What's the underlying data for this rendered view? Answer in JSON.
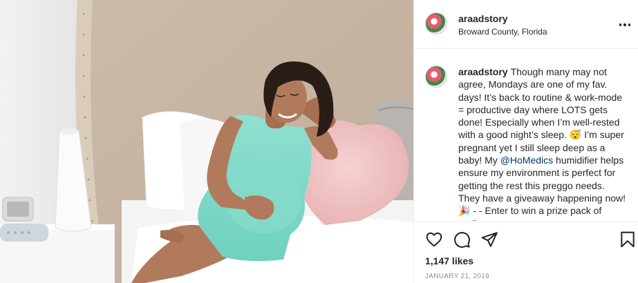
{
  "post": {
    "username": "araadstory",
    "location": "Broward County, Florida",
    "caption": {
      "username": "araadstory",
      "text_before_mention": "Though many may not agree, Mondays are one of my fav. days! It’s back to routine & work-mode = productive day where LOTS gets done! Especially when I’m well-rested with a good night’s sleep. 😴 I’m super pregnant yet I still sleep deep as a baby! My ",
      "mention": "@HoMedics",
      "text_after_mention": " humidifier helps ensure my environment is perfect for getting the rest this preggo needs. They have a giveaway happening now! 🎉 - - Enter to win a prize pack of really"
    },
    "likes": "1,147 likes",
    "date": "JANUARY 21, 2019"
  },
  "icons": {
    "more": "more-options-icon",
    "like": "heart-icon",
    "comment": "comment-icon",
    "share": "share-icon",
    "save": "bookmark-icon"
  },
  "colors": {
    "text": "#262626",
    "secondary": "#8e8e8e",
    "mention": "#00376b",
    "divider": "#efefef"
  }
}
